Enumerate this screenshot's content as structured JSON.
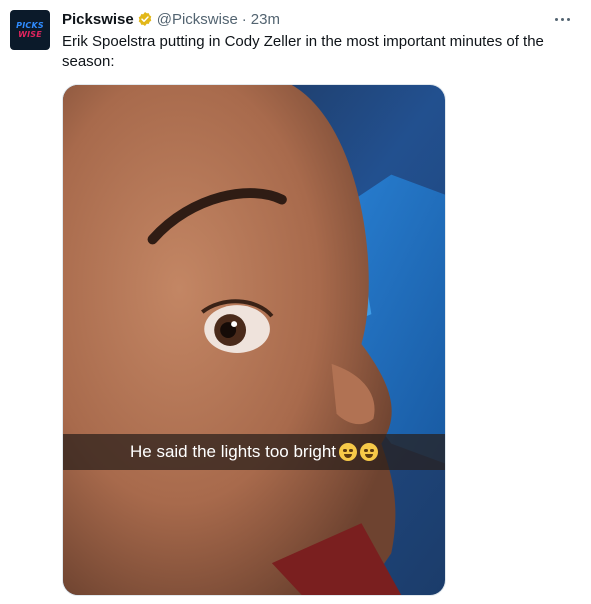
{
  "tweet": {
    "author": {
      "name": "Pickswise",
      "handle": "@Pickswise",
      "verified_badge": "verified-gold-badge",
      "avatar_text": [
        "PICKS",
        "WISE"
      ]
    },
    "separator": "·",
    "time": "23m",
    "text": "Erik Spoelstra putting in Cody Zeller in the most important minutes of the season:",
    "media": {
      "caption": "He said the lights too bright",
      "caption_emojis": [
        "crying-laughing-emoji",
        "crying-laughing-emoji"
      ]
    }
  },
  "icons": {
    "more": "more-horizontal-icon"
  },
  "colors": {
    "text_primary": "#0f1419",
    "text_secondary": "#536471",
    "verified_gold": "#e2b719",
    "avatar_bg": "#0b1a2a",
    "avatar_blue": "#2f8cff",
    "avatar_red": "#e0245e"
  }
}
